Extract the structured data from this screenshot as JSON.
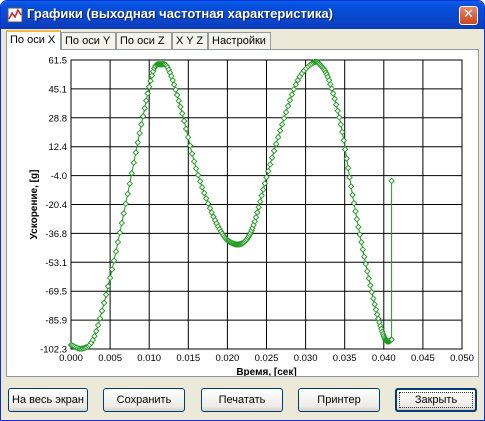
{
  "window": {
    "title": "Графики (выходная частотная характеристика)",
    "close_label": "✕"
  },
  "tabs": [
    {
      "label": "По оси X",
      "active": true
    },
    {
      "label": "По оси Y",
      "active": false
    },
    {
      "label": "По оси Z",
      "active": false
    },
    {
      "label": "X Y Z",
      "active": false
    },
    {
      "label": "Настройки",
      "active": false
    }
  ],
  "buttons": {
    "fullscreen": "На весь экран",
    "save": "Сохранить",
    "print": "Печатать",
    "printer": "Принтер",
    "close": "Закрыть"
  },
  "chart_data": {
    "type": "line",
    "title": "",
    "xlabel": "Время, [сек]",
    "ylabel": "Ускорение, [g]",
    "xlim": [
      0.0,
      0.05
    ],
    "ylim": [
      -102.3,
      61.5
    ],
    "x_ticks": [
      "0.000",
      "0.005",
      "0.010",
      "0.015",
      "0.020",
      "0.025",
      "0.030",
      "0.035",
      "0.040",
      "0.045",
      "0.050"
    ],
    "y_ticks": [
      "61.5",
      "45.1",
      "28.8",
      "12.4",
      "-4.0",
      "-20.4",
      "-36.8",
      "-53.1",
      "-69.5",
      "-85.9",
      "-102.3"
    ],
    "grid": true,
    "series_color": "#1f9a1f",
    "marker": "open-diamond",
    "x": [
      0.0,
      0.0015,
      0.003,
      0.005,
      0.007,
      0.009,
      0.0105,
      0.0115,
      0.0125,
      0.014,
      0.016,
      0.018,
      0.0195,
      0.0205,
      0.0215,
      0.0225,
      0.0235,
      0.025,
      0.027,
      0.029,
      0.031,
      0.032,
      0.033,
      0.0345,
      0.036,
      0.0375,
      0.039,
      0.04,
      0.0405,
      0.041,
      0.041
    ],
    "y": [
      -100,
      -102,
      -95,
      -62,
      -20,
      25,
      55,
      59,
      56,
      35,
      0,
      -25,
      -38,
      -42,
      -43,
      -40,
      -30,
      -5,
      25,
      50,
      60,
      58,
      50,
      25,
      -15,
      -50,
      -80,
      -95,
      -98,
      -97,
      -7
    ],
    "annotations": []
  }
}
